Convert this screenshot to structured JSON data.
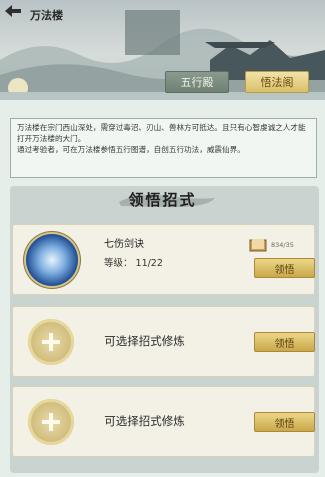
{
  "header": {
    "title": "万法楼"
  },
  "tabs": [
    {
      "label": "五行殿"
    },
    {
      "label": "悟法阁"
    }
  ],
  "description": {
    "line1": "万法楼在宗门西山深处，需穿过毒沼、刃山、兽林方可抵达。且只有心智虔诚之人才能打开万法楼的大门。",
    "line2": "通过考验者，可在万法楼参悟五行图谱，自创五行功法，威震仙界。"
  },
  "section": {
    "title": "领悟招式"
  },
  "skill": {
    "name": "七伤剑诀",
    "level_text": "等级：  11/22",
    "book_count": "834/35",
    "learn_label": "领悟"
  },
  "empty_slots": [
    {
      "text": "可选择招式修炼",
      "learn_label": "领悟"
    },
    {
      "text": "可选择招式修炼",
      "learn_label": "领悟"
    }
  ],
  "colors": {
    "accent": "#d9c06b",
    "panel": "#c9d4d0"
  }
}
